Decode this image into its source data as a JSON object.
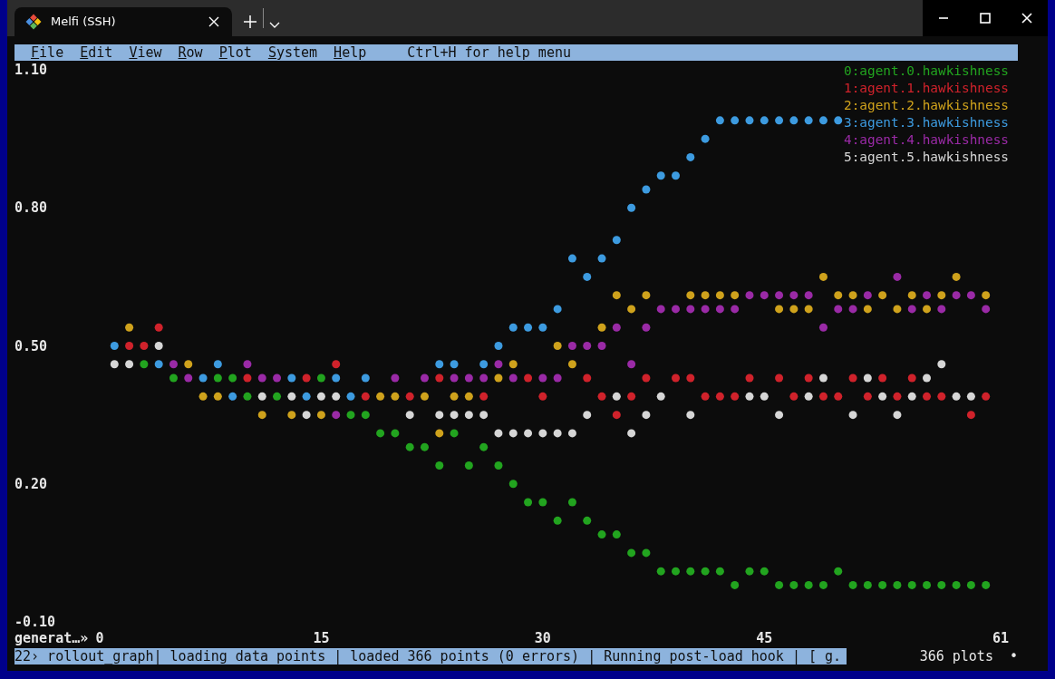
{
  "window": {
    "tab_title": "Melfi (SSH)"
  },
  "menu_bar": {
    "items": [
      "File",
      "Edit",
      "View",
      "Row",
      "Plot",
      "System",
      "Help"
    ],
    "hint": "Ctrl+H for help menu"
  },
  "plot": {
    "chart_data": {
      "type": "scatter",
      "xlabel": "generat…»",
      "xlim": [
        0,
        61
      ],
      "ylim": [
        -0.1,
        1.1
      ],
      "xticks": [
        0,
        15,
        30,
        45,
        61
      ],
      "yticks": [
        {
          "value": 1.1,
          "label": "1.10"
        },
        {
          "value": 0.8,
          "label": "0.80"
        },
        {
          "value": 0.5,
          "label": "0.50"
        },
        {
          "value": 0.2,
          "label": "0.20"
        },
        {
          "value": -0.1,
          "label": "-0.10"
        }
      ],
      "x": [
        1,
        2,
        3,
        4,
        5,
        6,
        7,
        8,
        9,
        10,
        11,
        12,
        13,
        14,
        15,
        16,
        17,
        18,
        19,
        20,
        21,
        22,
        23,
        24,
        25,
        26,
        27,
        28,
        29,
        30,
        31,
        32,
        33,
        34,
        35,
        36,
        37,
        38,
        39,
        40,
        41,
        42,
        43,
        44,
        45,
        46,
        47,
        48,
        49,
        50,
        51,
        52,
        53,
        54,
        55,
        56,
        57,
        58,
        59,
        60
      ],
      "series": [
        {
          "name": "0:agent.0.hawkishness",
          "color": "#22a41f",
          "values": [
            null,
            null,
            0.46,
            null,
            0.43,
            null,
            null,
            0.43,
            0.43,
            0.39,
            null,
            0.39,
            null,
            null,
            0.43,
            null,
            0.35,
            0.35,
            0.31,
            0.31,
            0.28,
            0.28,
            0.24,
            0.31,
            0.24,
            0.28,
            0.24,
            0.2,
            0.16,
            0.16,
            0.12,
            0.16,
            0.12,
            0.09,
            0.09,
            0.05,
            0.05,
            0.01,
            0.01,
            0.01,
            0.01,
            0.01,
            -0.02,
            0.01,
            0.01,
            -0.02,
            -0.02,
            -0.02,
            -0.02,
            0.01,
            -0.02,
            -0.02,
            -0.02,
            -0.02,
            -0.02,
            -0.02,
            -0.02,
            -0.02,
            -0.02,
            -0.02
          ]
        },
        {
          "name": "1:agent.1.hawkishness",
          "color": "#d0222b",
          "values": [
            null,
            0.5,
            0.5,
            0.54,
            null,
            null,
            null,
            null,
            null,
            0.43,
            null,
            null,
            null,
            0.43,
            null,
            0.46,
            null,
            0.39,
            null,
            null,
            0.39,
            null,
            0.43,
            null,
            null,
            0.39,
            null,
            null,
            0.43,
            0.39,
            null,
            null,
            0.43,
            0.39,
            0.35,
            0.39,
            0.43,
            null,
            0.43,
            0.43,
            0.39,
            0.39,
            0.39,
            0.43,
            null,
            0.43,
            0.39,
            0.43,
            0.39,
            0.39,
            0.43,
            0.39,
            0.43,
            0.39,
            0.43,
            0.39,
            0.39,
            null,
            0.35,
            0.39
          ]
        },
        {
          "name": "2:agent.2.hawkishness",
          "color": "#cfa21c",
          "values": [
            null,
            0.54,
            null,
            null,
            null,
            0.46,
            0.39,
            0.39,
            null,
            null,
            0.35,
            null,
            0.35,
            null,
            0.35,
            null,
            null,
            null,
            0.39,
            0.39,
            null,
            0.39,
            0.31,
            0.39,
            0.39,
            null,
            0.43,
            0.46,
            null,
            null,
            0.5,
            0.46,
            null,
            0.54,
            0.61,
            0.58,
            0.61,
            null,
            null,
            0.61,
            0.61,
            0.61,
            0.61,
            null,
            null,
            0.58,
            0.58,
            0.58,
            0.65,
            0.61,
            0.61,
            0.58,
            0.61,
            0.58,
            0.61,
            0.58,
            0.61,
            0.65,
            null,
            0.61
          ]
        },
        {
          "name": "3:agent.3.hawkishness",
          "color": "#3d9be0",
          "values": [
            0.5,
            null,
            null,
            0.46,
            null,
            null,
            0.43,
            0.46,
            0.39,
            null,
            null,
            null,
            0.43,
            0.39,
            null,
            0.43,
            0.39,
            0.43,
            null,
            null,
            null,
            null,
            0.46,
            0.46,
            null,
            0.46,
            0.5,
            0.54,
            0.54,
            0.54,
            0.58,
            0.69,
            0.65,
            0.69,
            0.73,
            0.8,
            0.84,
            0.87,
            0.87,
            0.91,
            0.95,
            0.99,
            0.99,
            0.99,
            0.99,
            0.99,
            0.99,
            0.99,
            0.99,
            0.99,
            null,
            null,
            null,
            null,
            null,
            null,
            null,
            null,
            null,
            null
          ]
        },
        {
          "name": "4:agent.4.hawkishness",
          "color": "#9a2aa6",
          "values": [
            null,
            null,
            null,
            null,
            0.46,
            0.43,
            null,
            null,
            null,
            0.46,
            0.43,
            0.43,
            null,
            null,
            null,
            0.35,
            null,
            null,
            null,
            0.43,
            null,
            0.43,
            null,
            0.43,
            0.43,
            0.43,
            0.46,
            0.43,
            null,
            0.43,
            0.43,
            0.5,
            0.5,
            0.5,
            0.54,
            0.46,
            0.54,
            0.58,
            0.58,
            0.58,
            0.58,
            0.58,
            0.58,
            0.61,
            0.61,
            0.61,
            0.61,
            0.61,
            0.54,
            0.58,
            0.58,
            0.61,
            null,
            0.65,
            0.58,
            0.61,
            0.58,
            0.61,
            0.61,
            0.58
          ]
        },
        {
          "name": "5:agent.5.hawkishness",
          "color": "#d6d6d6",
          "values": [
            0.46,
            0.46,
            null,
            0.5,
            null,
            null,
            null,
            null,
            null,
            null,
            0.39,
            null,
            0.39,
            0.35,
            0.39,
            0.39,
            null,
            null,
            null,
            null,
            0.35,
            null,
            0.35,
            0.35,
            0.35,
            0.35,
            0.31,
            0.31,
            0.31,
            0.31,
            0.31,
            0.31,
            0.35,
            null,
            0.39,
            0.31,
            0.35,
            0.39,
            null,
            0.35,
            null,
            null,
            null,
            0.39,
            0.39,
            0.35,
            null,
            0.39,
            0.43,
            null,
            0.35,
            0.43,
            0.39,
            0.35,
            0.39,
            0.43,
            0.46,
            0.39,
            0.39,
            null
          ]
        }
      ]
    }
  },
  "status_bar": {
    "text": "22› rollout_graph| loading data points | loaded 366 points (0 errors) | Running post-load hook | [ g.",
    "count": "366 plots",
    "indicator": "•"
  }
}
